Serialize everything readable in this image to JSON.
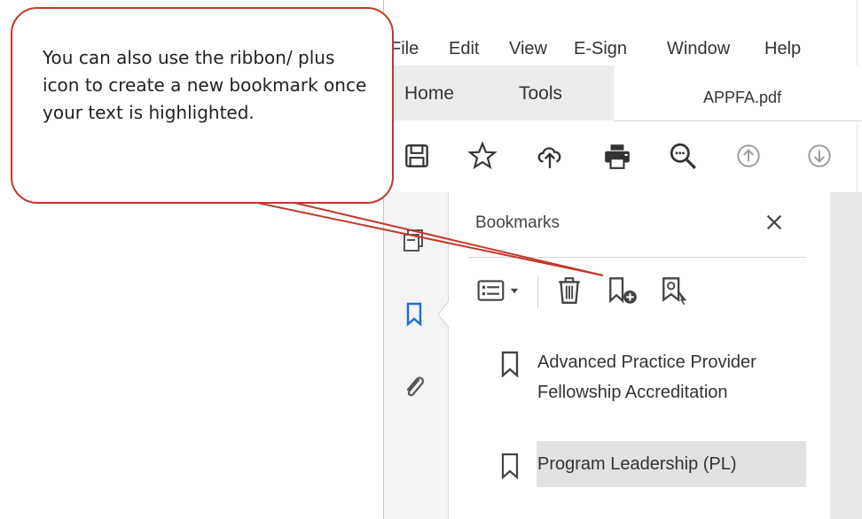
{
  "menu": {
    "items": [
      "File",
      "Edit",
      "View",
      "E-Sign",
      "Window",
      "Help"
    ]
  },
  "tabs": {
    "home_label": "Home",
    "tools_label": "Tools",
    "document_label": "APPFA.pdf"
  },
  "toolbar": {
    "icons": [
      "save-icon",
      "star-icon",
      "cloud-upload-icon",
      "print-icon",
      "zoom-icon",
      "previous-page-icon",
      "next-page-icon"
    ]
  },
  "leftrail": {
    "icons": [
      "page-thumbnails-icon",
      "bookmark-icon",
      "attachment-icon"
    ]
  },
  "bookmarks_panel": {
    "title": "Bookmarks",
    "items": [
      {
        "label": "Advanced Practice Provider Fellowship Accreditation"
      },
      {
        "label": "Program Leadership (PL)",
        "selected": true
      }
    ]
  },
  "callout": {
    "text": "You can also use the ribbon/ plus icon to create a new bookmark once your text is highlighted."
  },
  "colors": {
    "callout_border": "#c0392b",
    "pointer_line": "#c0392b",
    "bookmark_rail_accent": "#1e6bd6",
    "selected_row": "#e2e2e2"
  }
}
